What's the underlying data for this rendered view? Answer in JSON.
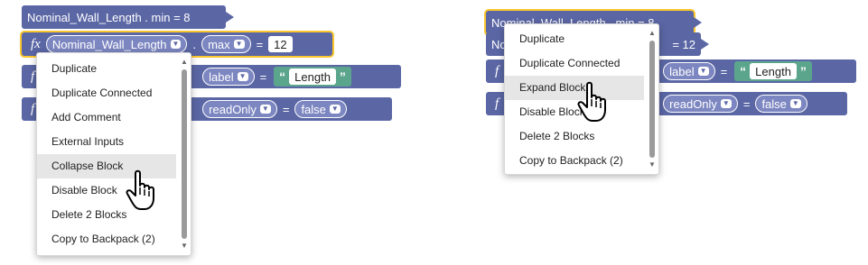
{
  "left": {
    "blocks": {
      "top_label": "Nominal_Wall_Length . min = 8",
      "row1": {
        "fx": "fx",
        "variable": "Nominal_Wall_Length",
        "dot": ".",
        "property": "max",
        "eq": "=",
        "value": "12"
      },
      "row2": {
        "fx": "f",
        "property": "label",
        "eq": "=",
        "open_quote": "“",
        "string_value": "Length",
        "close_quote": "”"
      },
      "row3": {
        "fx": "f",
        "property": "readOnly",
        "eq": "=",
        "value": "false"
      }
    },
    "menu": {
      "items": [
        {
          "label": "Duplicate"
        },
        {
          "label": "Duplicate Connected"
        },
        {
          "label": "Add Comment"
        },
        {
          "label": "External Inputs"
        },
        {
          "label": "Collapse Block"
        },
        {
          "label": "Disable Block"
        },
        {
          "label": "Delete 2 Blocks"
        },
        {
          "label": "Copy to Backpack (2)"
        }
      ],
      "highlighted": "Collapse Block"
    }
  },
  "right": {
    "blocks": {
      "top_label": "Nominal_Wall_Length . min = 8",
      "row1_label": "No",
      "row1_value": "= 12",
      "row2": {
        "fx": "f",
        "property": "label",
        "eq": "=",
        "open_quote": "“",
        "string_value": "Length",
        "close_quote": "”"
      },
      "row3": {
        "fx": "f",
        "property": "readOnly",
        "eq": "=",
        "value": "false"
      }
    },
    "menu": {
      "items": [
        {
          "label": "Duplicate"
        },
        {
          "label": "Duplicate Connected"
        },
        {
          "label": "Expand Block"
        },
        {
          "label": "Disable Block"
        },
        {
          "label": "Delete 2 Blocks"
        },
        {
          "label": "Copy to Backpack (2)"
        }
      ],
      "highlighted": "Expand Block"
    }
  },
  "colors": {
    "block": "#5b67a5",
    "string_block": "#5ba58c",
    "selection": "#fcc72e",
    "menu_highlight": "#e6e6e6"
  },
  "icons": {
    "cursor": "hand-pointer-icon",
    "dropdown": "chevron-down-icon"
  }
}
